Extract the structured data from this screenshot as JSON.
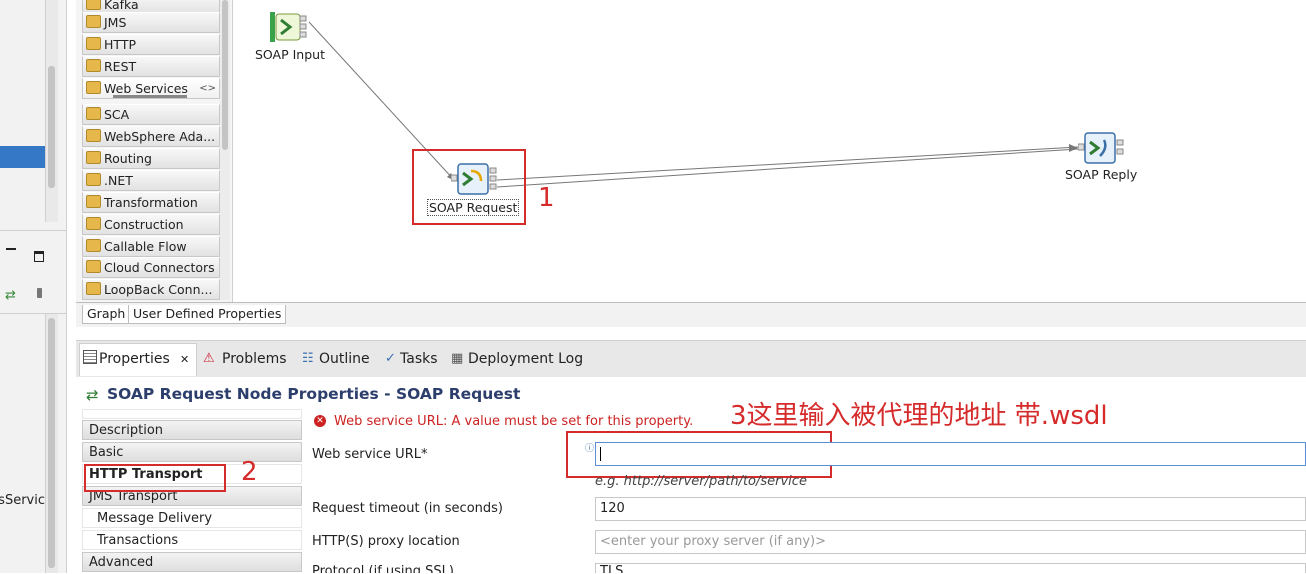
{
  "palette": {
    "items": [
      {
        "label": "Kafka",
        "icon": "kafka-icon"
      },
      {
        "label": "JMS",
        "icon": "jms-folder-icon"
      },
      {
        "label": "HTTP",
        "icon": "http-folder-icon"
      },
      {
        "label": "REST",
        "icon": "rest-folder-icon"
      },
      {
        "label": "Web Services",
        "icon": "web-services-folder-icon"
      },
      {
        "label": "SCA",
        "icon": "sca-folder-icon"
      },
      {
        "label": "WebSphere Ada...",
        "icon": "websphere-adapters-folder-icon"
      },
      {
        "label": "Routing",
        "icon": "routing-folder-icon"
      },
      {
        "label": ".NET",
        "icon": "dotnet-folder-icon"
      },
      {
        "label": "Transformation",
        "icon": "transformation-folder-icon"
      },
      {
        "label": "Construction",
        "icon": "construction-folder-icon"
      },
      {
        "label": "Callable Flow",
        "icon": "callable-flow-folder-icon"
      },
      {
        "label": "Cloud Connectors",
        "icon": "cloud-connectors-folder-icon"
      },
      {
        "label": "LoopBack Conn...",
        "icon": "loopback-folder-icon"
      }
    ],
    "expand_glyph": "<>"
  },
  "left_pane": {
    "partial_text": "esServic"
  },
  "canvas": {
    "nodes": [
      {
        "label": "SOAP Input"
      },
      {
        "label": "SOAP Request"
      },
      {
        "label": "SOAP Reply"
      }
    ],
    "annotation_1": "1",
    "annotation_2": "2",
    "annotation_3": "3这里输入被代理的地址 带.wsdl"
  },
  "canvas_tabs": [
    "Graph",
    "User Defined Properties"
  ],
  "views": {
    "tabs": [
      "Properties",
      "Problems",
      "Outline",
      "Tasks",
      "Deployment Log"
    ],
    "close_glyph": "✕"
  },
  "properties": {
    "title": "SOAP Request Node Properties - SOAP Request",
    "nav": [
      "Description",
      "Basic",
      "HTTP Transport",
      "JMS Transport",
      "Message Delivery",
      "Transactions",
      "Advanced"
    ],
    "error": "Web service URL: A value must be set for this property.",
    "fields": {
      "url_label": "Web service URL*",
      "url_value": "",
      "url_hint": "e.g. http://server/path/to/service",
      "timeout_label": "Request timeout (in seconds)",
      "timeout_value": "120",
      "proxy_label": "HTTP(S) proxy location",
      "proxy_placeholder": "<enter your proxy server (if any)>",
      "protocol_label": "Protocol (if using SSL)",
      "protocol_value": "TLS"
    }
  },
  "colors": {
    "annotation_red": "#d62b2b",
    "selection_blue": "#3478c6",
    "title_blue": "#2c3e6b",
    "error_red": "#cc2222"
  }
}
